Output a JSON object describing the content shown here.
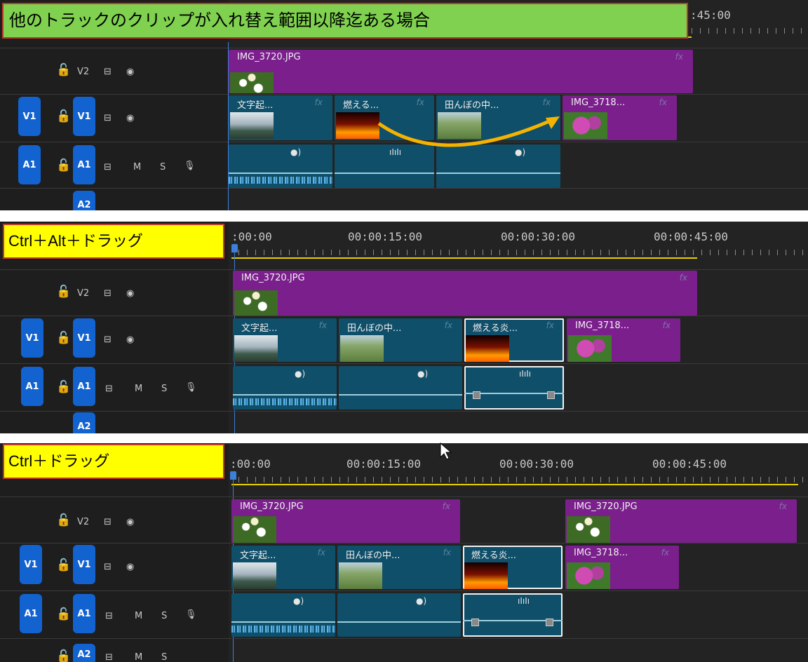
{
  "notes": {
    "top": "他のトラックのクリップが入れ替え範囲以降迄ある場合",
    "middle": "Ctrl＋Alt＋ドラッグ",
    "bottom": "Ctrl＋ドラッグ"
  },
  "timecodes": {
    "t0": ":00:00",
    "t15": "00:00:15:00",
    "t30": "00:00:30:00",
    "t45": "00:00:45:00",
    "t45_cropped": ":45:00"
  },
  "tracks": {
    "v2": "V2",
    "v1": "V1",
    "a1": "A1",
    "a2": "A2",
    "m": "M",
    "s": "S"
  },
  "clips": {
    "img3720": "IMG_3720.JPG",
    "moji": "文字起...",
    "moeru_short": "燃える...",
    "moeru": "燃える炎...",
    "tanbo": "田んぼの中...",
    "img3718": "IMG_3718...",
    "fx": "fx"
  },
  "colors": {
    "purple_clip": "#7a1f8c",
    "video_clip": "#0f4f69",
    "track_tag": "#1262d0",
    "arrow": "#f5b300",
    "note_green": "#7fd14f",
    "note_yellow": "#ffff00"
  },
  "icons": [
    "lock-icon",
    "camera-icon",
    "eye-icon",
    "mic-icon",
    "speaker-icon",
    "waveform-icon",
    "arrow-icon",
    "cursor-icon"
  ]
}
